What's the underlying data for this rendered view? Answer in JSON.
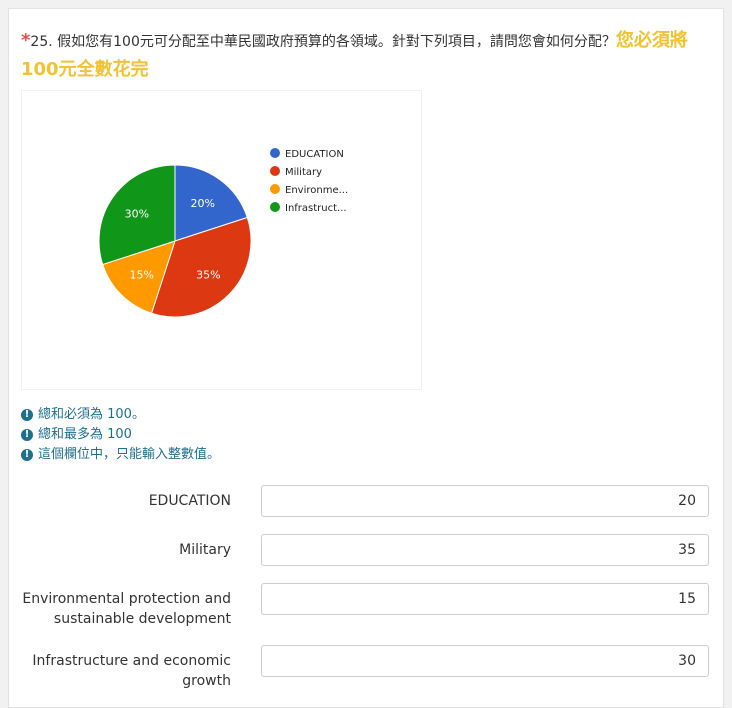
{
  "question": {
    "asterisk": "*",
    "text": "25. 假如您有100元可分配至中華民國政府預算的各領域。針對下列項目，請問您會如何分配？",
    "emphasis": "您必須將100元全數花完"
  },
  "chart_data": {
    "type": "pie",
    "categories": [
      "EDUCATION",
      "Military",
      "Environmental protection and sustainable development",
      "Infrastructure and economic growth"
    ],
    "legend_labels": [
      "EDUCATION",
      "Military",
      "Environme...",
      "Infrastruct..."
    ],
    "values": [
      20,
      35,
      15,
      30
    ],
    "slice_labels": [
      "20%",
      "35%",
      "15%",
      "30%"
    ],
    "colors": [
      "#3366cc",
      "#dc3912",
      "#ff9900",
      "#109618"
    ],
    "legend": "right"
  },
  "tips": [
    "總和必須為 100。",
    "總和最多為 100",
    "這個欄位中，只能輸入整數值。"
  ],
  "rows": [
    {
      "label_lines": [
        "EDUCATION"
      ],
      "value": "20"
    },
    {
      "label_lines": [
        "Military"
      ],
      "value": "35"
    },
    {
      "label_lines": [
        "Environmental protection and",
        "sustainable development"
      ],
      "value": "15"
    },
    {
      "label_lines": [
        "Infrastructure and economic",
        "growth"
      ],
      "value": "30"
    }
  ]
}
